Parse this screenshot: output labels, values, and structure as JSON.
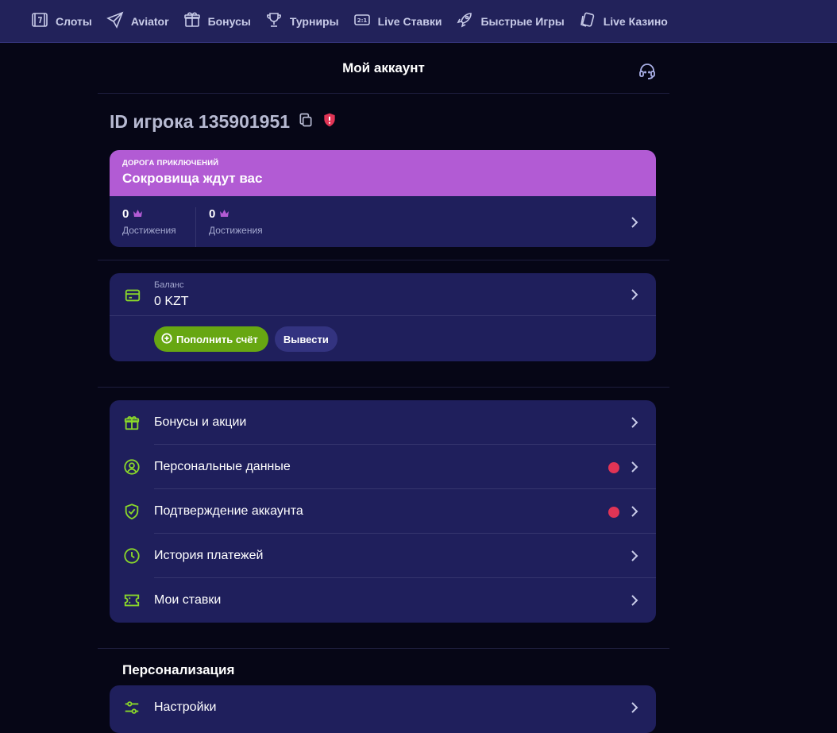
{
  "nav": {
    "items": [
      {
        "label": "Слоты",
        "icon": "slots-icon"
      },
      {
        "label": "Aviator",
        "icon": "plane-icon"
      },
      {
        "label": "Бонусы",
        "icon": "gift-icon"
      },
      {
        "label": "Турниры",
        "icon": "trophy-icon"
      },
      {
        "label": "Live Ставки",
        "icon": "live-bets-icon"
      },
      {
        "label": "Быстрые Игры",
        "icon": "rocket-icon"
      },
      {
        "label": "Live Казино",
        "icon": "cards-icon"
      }
    ]
  },
  "header": {
    "title": "Мой аккаунт"
  },
  "player": {
    "id_label": "ID игрока 135901951"
  },
  "adventure": {
    "kicker": "ДОРОГА ПРИКЛЮЧЕНИЙ",
    "title": "Сокровища ждут вас",
    "stats": [
      {
        "value": "0",
        "label": "Достижения"
      },
      {
        "value": "0",
        "label": "Достижения"
      }
    ]
  },
  "balance": {
    "label": "Баланс",
    "value": "0 KZT",
    "deposit_label": "Пополнить счёт",
    "withdraw_label": "Вывести"
  },
  "menu": {
    "items": [
      {
        "label": "Бонусы и акции",
        "icon": "gift-icon",
        "alert": false
      },
      {
        "label": "Персональные данные",
        "icon": "user-icon",
        "alert": true
      },
      {
        "label": "Подтверждение аккаунта",
        "icon": "shield-check-icon",
        "alert": true
      },
      {
        "label": "История платежей",
        "icon": "clock-icon",
        "alert": false
      },
      {
        "label": "Мои ставки",
        "icon": "ticket-icon",
        "alert": false
      }
    ]
  },
  "personalization": {
    "title": "Персонализация",
    "settings_label": "Настройки"
  },
  "colors": {
    "accent_green": "#8ad82a",
    "deposit_green": "#67a712",
    "purple_banner": "#b25bd4",
    "card_bg": "#1f1f5c",
    "alert_red": "#e03455"
  }
}
